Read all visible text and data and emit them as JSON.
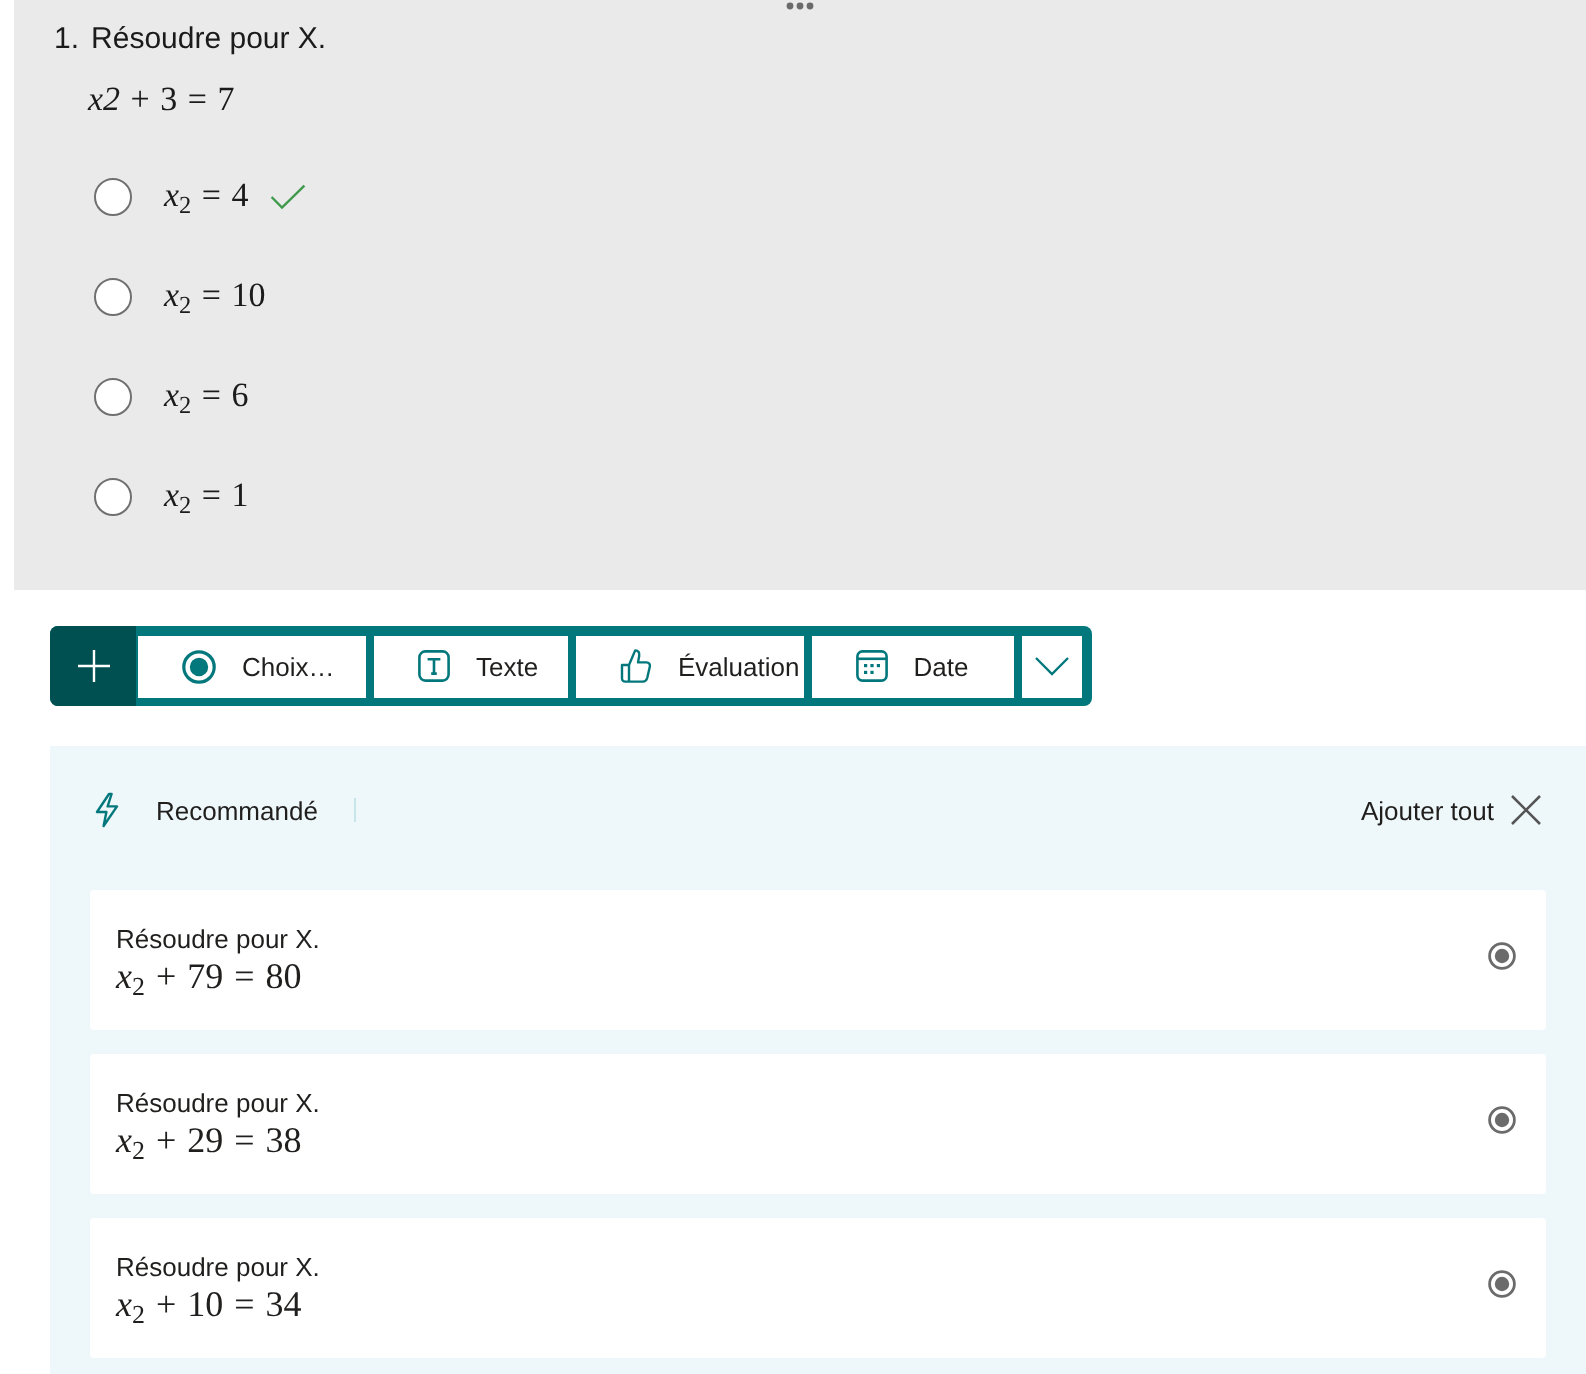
{
  "question": {
    "number": "1.",
    "title": "Résoudre pour X.",
    "equation": "*x2* + 3 = 7",
    "options": [
      {
        "label": "*x*$_{2}$ = 4",
        "selected": false,
        "correct": true
      },
      {
        "label": "*x*$_{2}$ = 10",
        "selected": false,
        "correct": false
      },
      {
        "label": "*x*$_{2}$ = 6",
        "selected": false,
        "correct": false
      },
      {
        "label": "*x*$_{2}$ = 1",
        "selected": false,
        "correct": false
      }
    ]
  },
  "toolbar": {
    "items": [
      {
        "kind": "add"
      },
      {
        "kind": "choice",
        "label": "Choix…"
      },
      {
        "kind": "text",
        "label": "Texte"
      },
      {
        "kind": "rating",
        "label": "Évaluation"
      },
      {
        "kind": "date",
        "label": "Date"
      },
      {
        "kind": "more"
      }
    ]
  },
  "recommended": {
    "title": "Recommandé",
    "add_all": "Ajouter tout",
    "suggestions": [
      {
        "title": "Résoudre pour X.",
        "equation": "*x*$_{2}$ + 79 = 80"
      },
      {
        "title": "Résoudre pour X.",
        "equation": "*x*$_{2}$ + 29 = 38"
      },
      {
        "title": "Résoudre pour X.",
        "equation": "*x*$_{2}$ + 10 = 34"
      }
    ]
  }
}
